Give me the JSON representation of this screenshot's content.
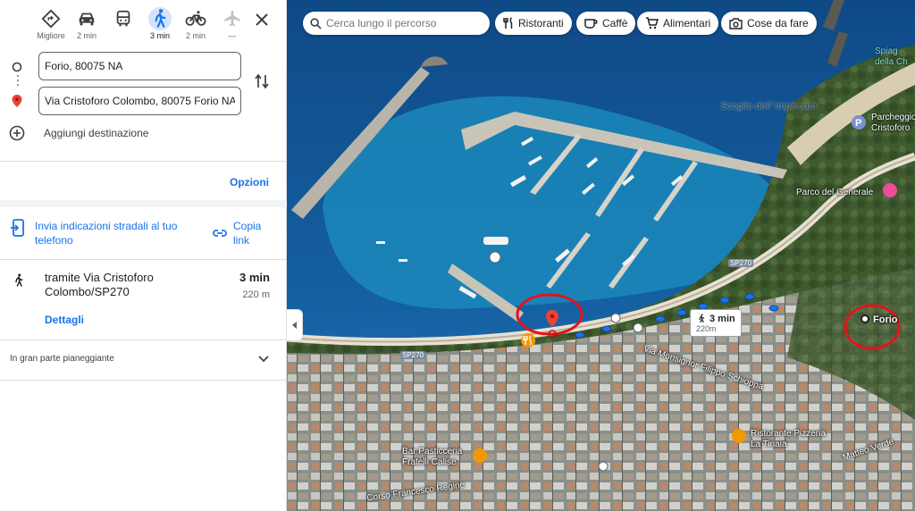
{
  "modes": [
    {
      "name": "best",
      "icon": "diamond-route-icon",
      "label": "Migliore"
    },
    {
      "name": "car",
      "icon": "car-icon",
      "label": "2 min"
    },
    {
      "name": "transit",
      "icon": "bus-icon",
      "label": ""
    },
    {
      "name": "walk",
      "icon": "walk-icon",
      "label": "3 min",
      "active": true
    },
    {
      "name": "bike",
      "icon": "bike-icon",
      "label": "2 min"
    },
    {
      "name": "flight",
      "icon": "plane-icon",
      "label": "—"
    }
  ],
  "origin": "Forio, 80075 NA",
  "destination": "Via Cristoforo Colombo, 80075 Forio NA",
  "add_destination": "Aggiungi destinazione",
  "options_label": "Opzioni",
  "send_directions": "Invia indicazioni stradali al tuo telefono",
  "copy_link": "Copia link",
  "route": {
    "via": "tramite Via Cristoforo Colombo/SP270",
    "time": "3 min",
    "distance": "220 m",
    "details": "Dettagli"
  },
  "route_note": "In gran parte pianeggiante",
  "map": {
    "search_placeholder": "Cerca lungo il percorso",
    "chips": [
      {
        "icon": "fork-knife-icon",
        "label": "Ristoranti"
      },
      {
        "icon": "coffee-icon",
        "label": "Caffè"
      },
      {
        "icon": "cart-icon",
        "label": "Alimentari"
      },
      {
        "icon": "camera-icon",
        "label": "Cose da fare"
      }
    ],
    "labels": {
      "scoglio": "Scoglio dell' impiccato",
      "spiaggia": "Spiag della Ch",
      "parcheggio": "Parcheggio Cristoforo",
      "parco": "Parco del Generale",
      "via_monsignor": "Via Monsignor Filippo Schioppa",
      "bar": "Bar Pasticceria Fratelli Calise",
      "ristorante": "Ristorante Pizzeria La Tinaia",
      "corso": "Corso Francesco Regine",
      "matteo": "Matteo Verde",
      "forio": "Forio"
    },
    "road_shields": [
      "SP270",
      "SP270"
    ],
    "eta": {
      "time": "3 min",
      "distance": "220m"
    },
    "colors": {
      "route_dot": "#1a73e8",
      "highlight_circle": "#e3141a",
      "pin": "#ea4335",
      "food_poi": "#f29900",
      "shop_poi": "#ee4b9b"
    }
  }
}
